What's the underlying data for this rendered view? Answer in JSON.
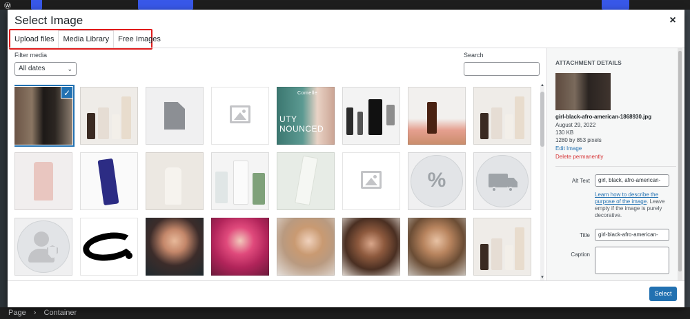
{
  "modal": {
    "title": "Select Image",
    "close_symbol": "×"
  },
  "tabs": [
    {
      "label": "Upload files",
      "active": false
    },
    {
      "label": "Media Library",
      "active": true
    },
    {
      "label": "Free Images",
      "active": false
    }
  ],
  "filter": {
    "label": "Filter media",
    "selected": "All dates",
    "chevron": "⌄"
  },
  "search": {
    "label": "Search",
    "value": ""
  },
  "grid_icons": {
    "check": "✓",
    "percent": "%",
    "scroll_up": "▲",
    "scroll_down": "▼"
  },
  "grid_photo_texts": {
    "brand": "Comelle",
    "banner": "UTY\nNOUNCED"
  },
  "attachment": {
    "heading": "ATTACHMENT DETAILS",
    "filename": "girl-black-afro-american-1868930.jpg",
    "date": "August 29, 2022",
    "size": "130 KB",
    "dimensions": "1280 by 853 pixels",
    "edit_link": "Edit Image",
    "delete_link": "Delete permanently",
    "alt_text_label": "Alt Text",
    "alt_text_value": "girl, black, afro-american-",
    "alt_help_link": "Learn how to describe the purpose of the image",
    "alt_help_rest": ". Leave empty if the image is purely decorative.",
    "title_label": "Title",
    "title_value": "girl-black-afro-american-",
    "caption_label": "Caption"
  },
  "footer": {
    "select_label": "Select"
  },
  "background": {
    "breadcrumb_page": "Page",
    "breadcrumb_sep": "›",
    "breadcrumb_container": "Container"
  },
  "colors": {
    "accent": "#2271b1",
    "highlight_box": "#e01a1a",
    "delete": "#d63638"
  }
}
